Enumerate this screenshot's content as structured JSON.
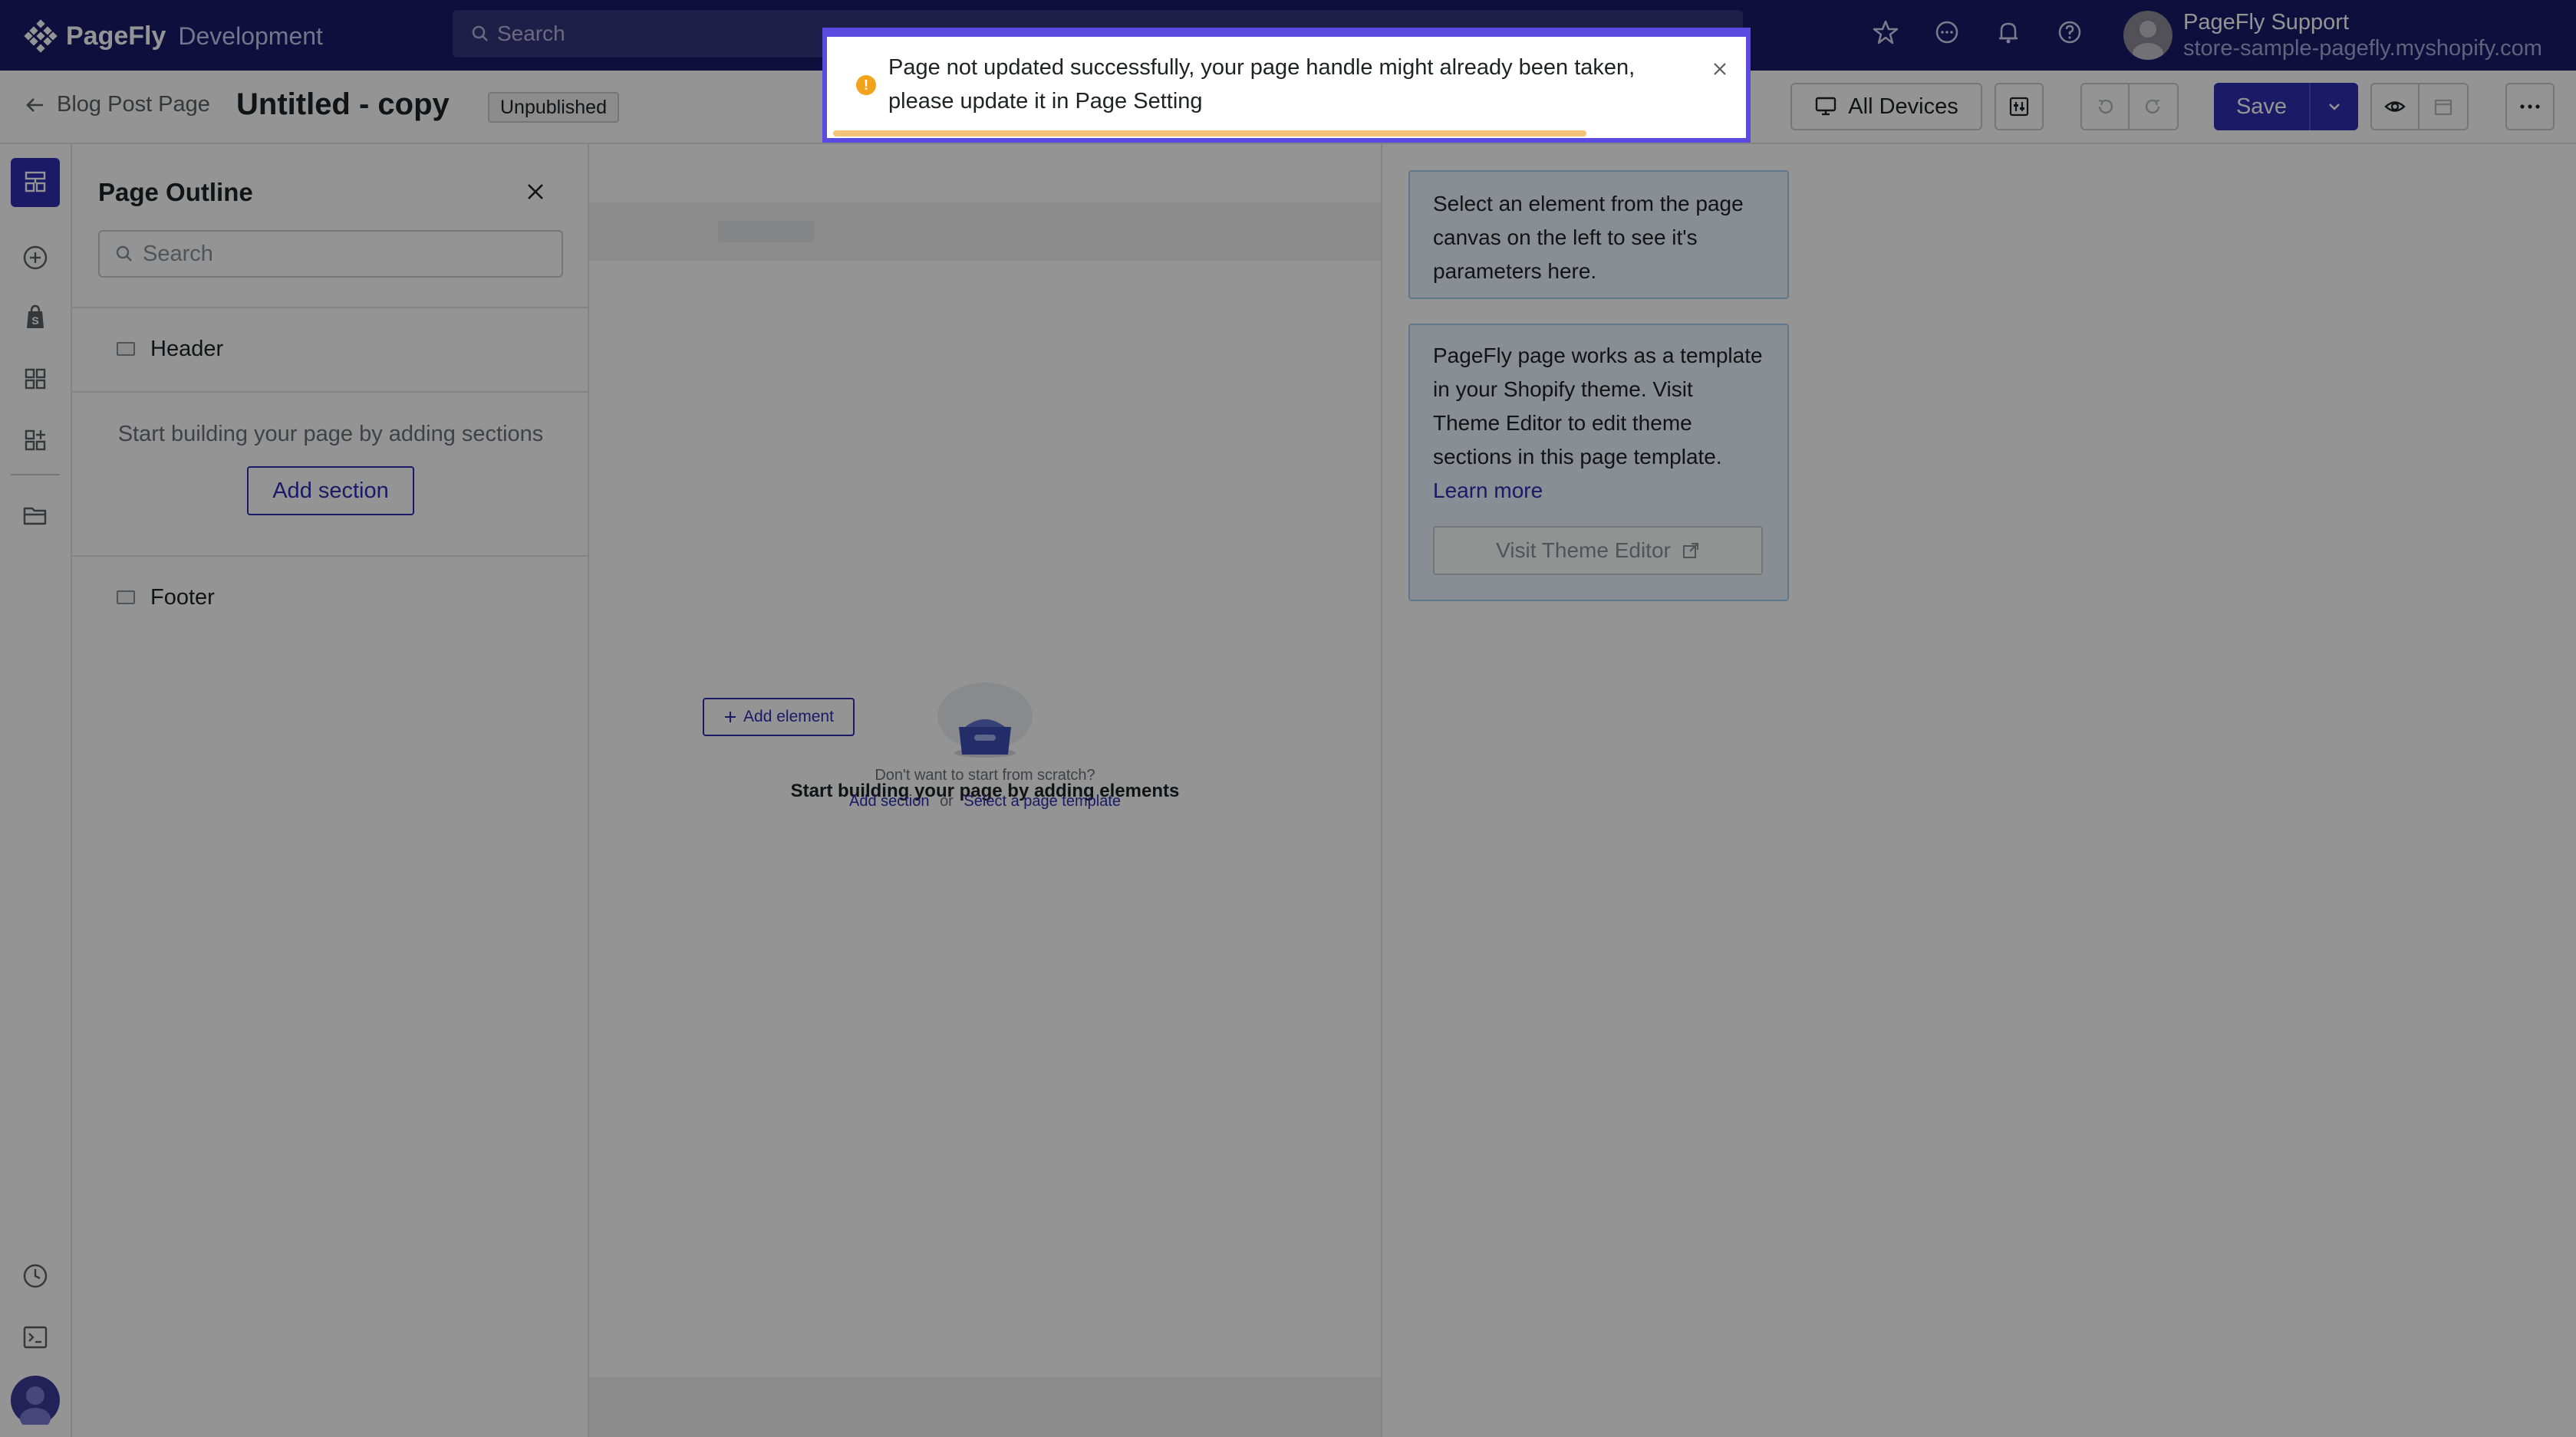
{
  "topbar": {
    "brand": "PageFly",
    "env": "Development",
    "search_placeholder": "Search",
    "user_name": "PageFly Support",
    "user_store": "store-sample-pagefly.myshopify.com"
  },
  "subbar": {
    "back_label": "Blog Post Page",
    "page_title": "Untitled - copy",
    "status": "Unpublished",
    "devices_label": "All Devices",
    "save_label": "Save"
  },
  "outline": {
    "title": "Page Outline",
    "search_placeholder": "Search",
    "header_label": "Header",
    "empty_text": "Start building your page by adding sections",
    "add_section_label": "Add section",
    "footer_label": "Footer"
  },
  "canvas": {
    "empty_title": "Start building your page by adding elements",
    "add_element_label": "Add element",
    "hint": "Don't want to start from scratch?",
    "link_add_section": "Add section",
    "or": "or",
    "link_template": "Select a page template"
  },
  "right": {
    "info1": "Select an element from the page canvas on the left to see it's parameters here.",
    "info2": "PageFly page works as a template in your Shopify theme. Visit Theme Editor to edit theme sections in this page template.",
    "learn_more": "Learn more",
    "visit_label": "Visit Theme Editor"
  },
  "toast": {
    "message": "Page not updated successfully, your page handle might already been taken, please update it in Page Setting",
    "progress": 0.82
  },
  "colors": {
    "brand": "#1b1a6b",
    "accent": "#2d2db0",
    "warning": "#f2a31b"
  }
}
